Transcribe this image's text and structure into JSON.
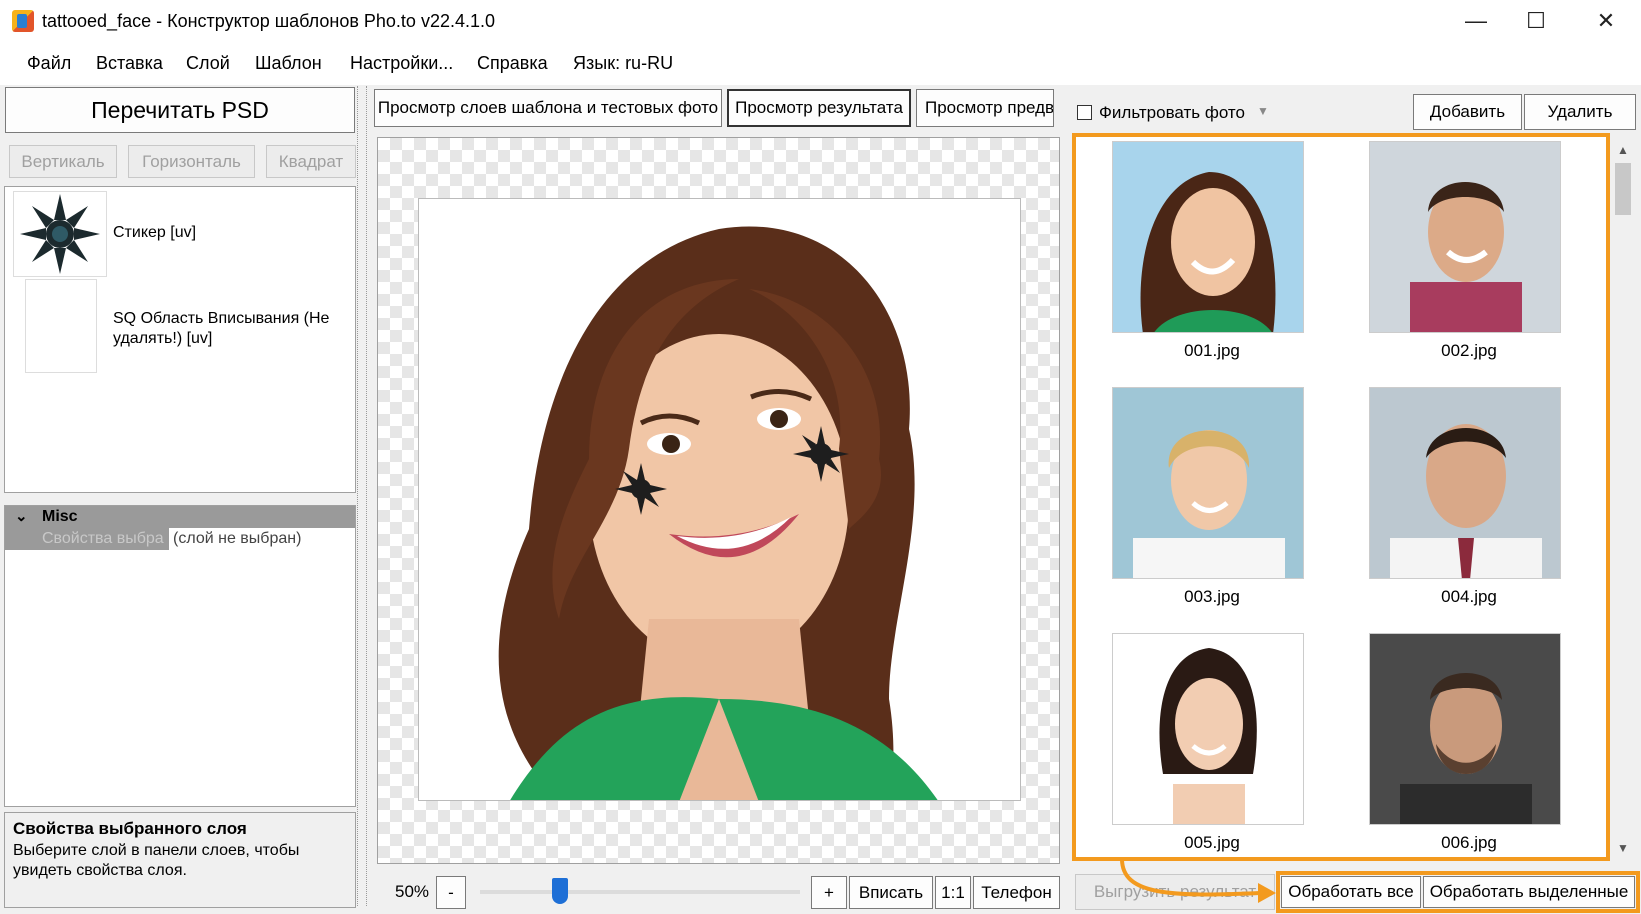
{
  "window": {
    "title": "tattooed_face - Конструктор шаблонов Pho.to v22.4.1.0",
    "minimize": "—",
    "maximize": "☐",
    "close": "✕"
  },
  "menu": [
    "Файл",
    "Вставка",
    "Слой",
    "Шаблон",
    "Настройки...",
    "Справка",
    "Язык: ru-RU"
  ],
  "left": {
    "reread_psd": "Перечитать PSD",
    "orientation": [
      "Вертикаль",
      "Горизонталь",
      "Квадрат"
    ],
    "layers": [
      {
        "label": "Стикер [uv]"
      },
      {
        "label": "SQ Область Вписывания (Не удалять!) [uv]"
      }
    ],
    "props": {
      "group": "Misc",
      "row_name": "Свойства выбра",
      "row_value": "(слой не выбран)"
    },
    "help": {
      "title": "Свойства выбранного слоя",
      "text": "Выберите слой в панели слоев, чтобы увидеть свойства слоя."
    }
  },
  "center": {
    "tabs": [
      "Просмотр слоев шаблона и тестовых фото",
      "Просмотр результата",
      "Просмотр предв"
    ],
    "zoom_label": "50%",
    "zoom_minus": "-",
    "zoom_plus": "+",
    "zoom_percent": 0.25,
    "fit": "Вписать",
    "one_to_one": "1:1",
    "phone": "Телефон"
  },
  "right": {
    "filter_label": "Фильтровать фото",
    "add": "Добавить",
    "delete": "Удалить",
    "photos": [
      "001.jpg",
      "002.jpg",
      "003.jpg",
      "004.jpg",
      "005.jpg",
      "006.jpg"
    ],
    "save_result": "Выгрузить результат",
    "process_all": "Обработать все",
    "process_selected": "Обработать выделенные"
  },
  "colors": {
    "highlight": "#f39a1e"
  }
}
